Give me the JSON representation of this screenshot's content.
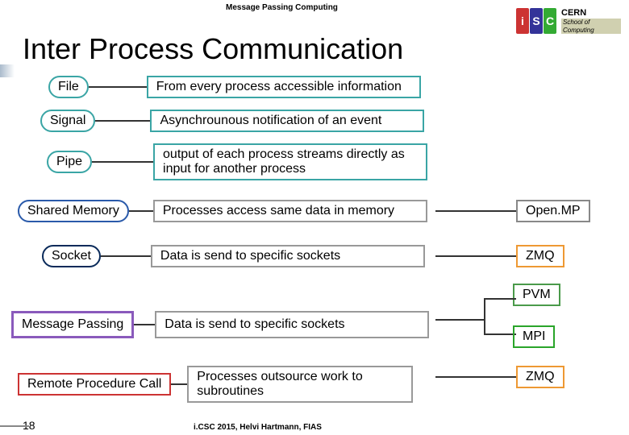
{
  "header": {
    "subject": "Message Passing Computing"
  },
  "logo": {
    "brand": "CERN",
    "school": "School of Computing"
  },
  "title": "Inter Process Communication",
  "rows": {
    "file": {
      "label": "File",
      "desc": "From every process accessible information"
    },
    "signal": {
      "label": "Signal",
      "desc": "Asynchrounous notification of an event"
    },
    "pipe": {
      "label": "Pipe",
      "desc": "output of each process streams directly as input for another process"
    },
    "shmem": {
      "label": "Shared Memory",
      "desc": "Processes access same data in memory",
      "tech": "Open.MP"
    },
    "socket": {
      "label": "Socket",
      "desc": "Data is send to specific sockets",
      "tech": "ZMQ"
    },
    "mp": {
      "label": "Message Passing",
      "desc": "Data is send to specific sockets",
      "tech1": "PVM",
      "tech2": "MPI"
    },
    "rpc": {
      "label": "Remote Procedure Call",
      "desc": "Processes outsource work to subroutines",
      "tech": "ZMQ"
    }
  },
  "page": "18",
  "footer": "i.CSC 2015, Helvi Hartmann, FIAS"
}
